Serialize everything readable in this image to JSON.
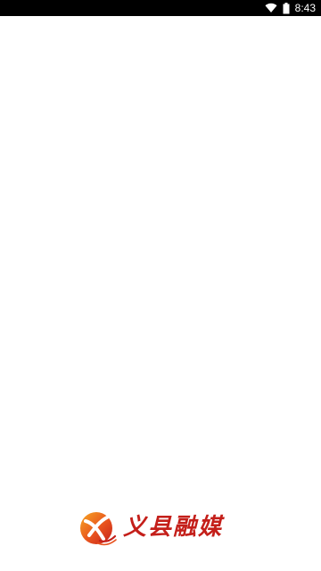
{
  "status_bar": {
    "time": "8:43",
    "icons": [
      "wifi-icon",
      "battery-icon"
    ]
  },
  "splash": {
    "app_name": "义县融媒",
    "brand_color": "#c41f1a",
    "logo_colors": [
      "#f7a823",
      "#e8531e",
      "#c41f1a"
    ]
  }
}
